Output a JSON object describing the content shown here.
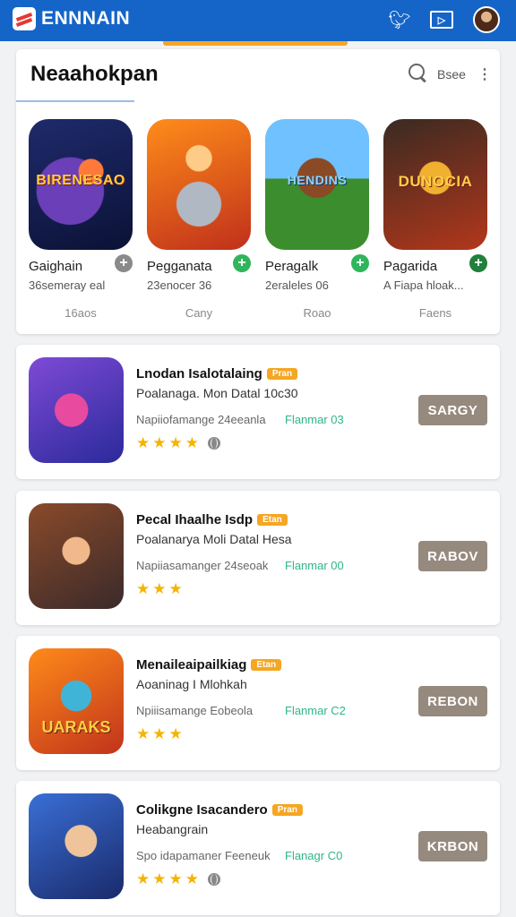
{
  "app": {
    "brand": "ENNNAIN"
  },
  "topbar_icons": [
    "bird-icon",
    "tv-icon",
    "avatar"
  ],
  "featured": {
    "title": "Neaahokpan",
    "sort_label": "Bsee",
    "games": [
      {
        "name": "Gaighain",
        "sub": "36semeray eal",
        "foot": "16aos",
        "thumb_text": "BIRENESAO",
        "add_style": "grey"
      },
      {
        "name": "Pegganata",
        "sub": "23enocer 36",
        "foot": "Cany",
        "thumb_text": "",
        "add_style": "green"
      },
      {
        "name": "Peragalk",
        "sub": "2eraleles 06",
        "foot": "Roao",
        "thumb_text": "HENDINS",
        "add_style": "green"
      },
      {
        "name": "Pagarida",
        "sub": "A Fiapa hloak...",
        "foot": "Faens",
        "thumb_text": "DUNOCIA",
        "add_style": "dark"
      }
    ]
  },
  "list": [
    {
      "title": "Lnodan Isalotalaing",
      "badge": "Pran",
      "sub": "Poalanaga. Mon Datal 10c30",
      "meta": "Napiiofamange 24eeanla",
      "green": "Flanmar 03",
      "rating": 4,
      "button": "SARGY"
    },
    {
      "title": "Pecal Ihaalhe Isdp",
      "badge": "Etan",
      "sub": "Poalanarya Moli Datal Hesa",
      "meta": "Napiiasamanger 24seoak",
      "green": "Flanmar 00",
      "rating": 3,
      "button": "RABOV"
    },
    {
      "title": "Menaileaipailkiag",
      "badge": "Etan",
      "sub": "Aoaninag I Mlohkah",
      "meta": "Npiiisamange Eobeola",
      "green": "Flanmar C2",
      "rating": 3,
      "button": "REBON",
      "thumb_text": "UARAKS"
    },
    {
      "title": "Colikgne Isacandero",
      "badge": "Pran",
      "sub": "Heabangrain",
      "meta": "Spo idapamaner Feeneuk",
      "green": "Flanagr C0",
      "rating": 4,
      "button": "KRBON"
    }
  ],
  "colors": {
    "topbar": "#1565c8",
    "accent": "#f6a623",
    "button": "#968a7e",
    "star": "#f5b400",
    "green_text": "#2fb58a"
  }
}
